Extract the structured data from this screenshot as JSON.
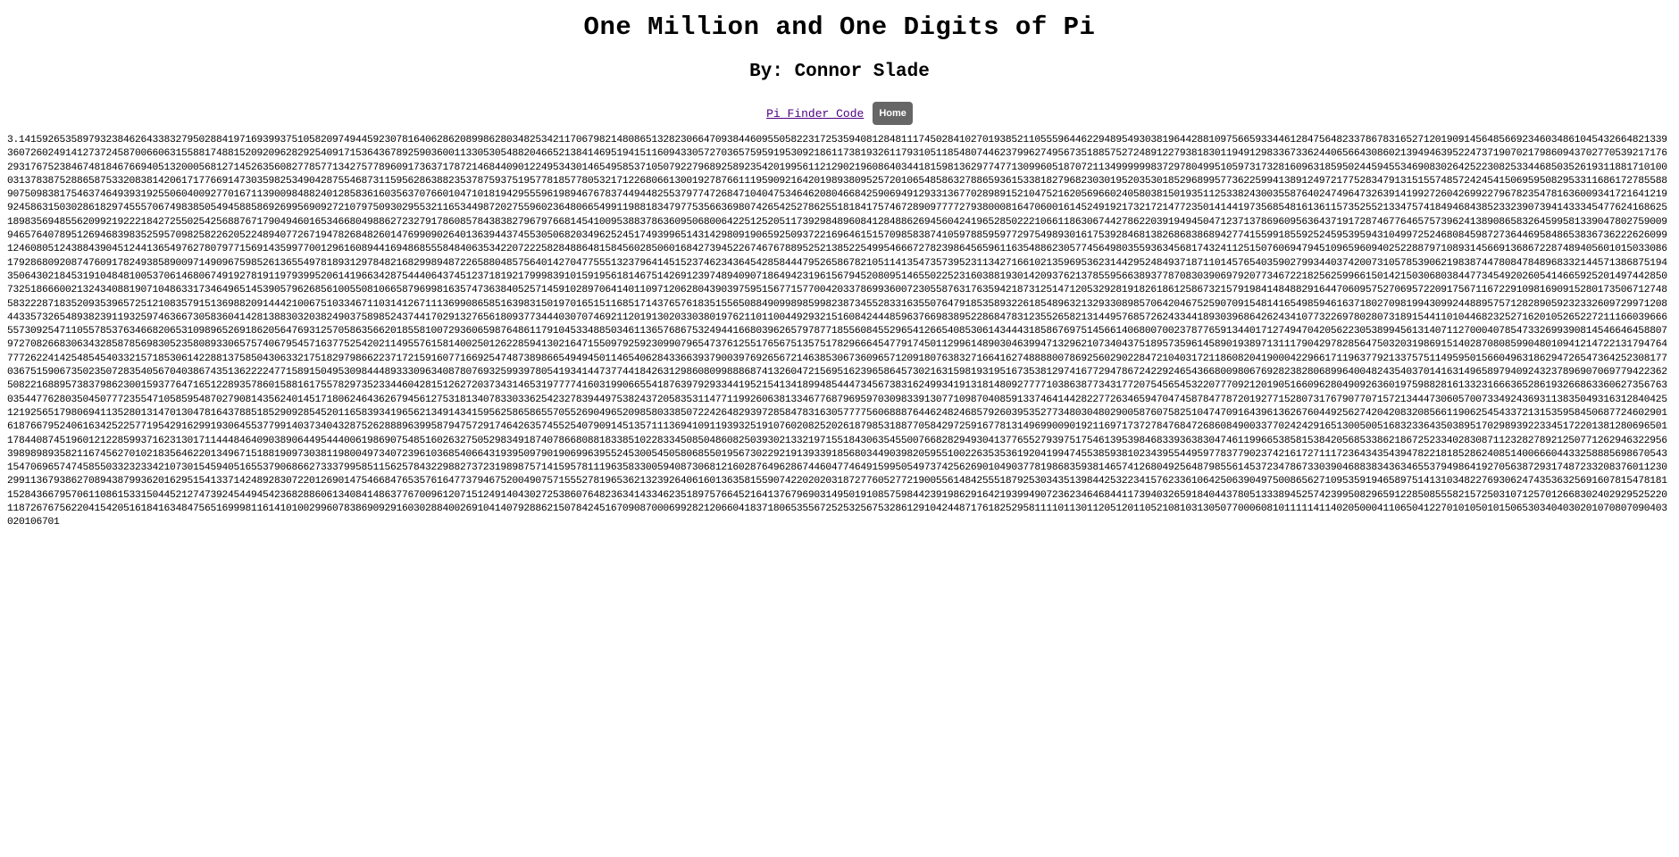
{
  "page": {
    "title": "One Million and One Digits of Pi",
    "subtitle": "By: Connor Slade"
  },
  "nav": {
    "link_label": "Pi Finder Code",
    "home_label": "Home"
  },
  "pi_digits": "3.14159265358979323846264338327950288419716939937510582097494459230781640628620899862803482534211706798214808651328230664709384460955058223172535940812848111745028410270193852110555964462294895493038196442881097566593344612847564823378678316527120190914564856692346034861045432664821339360726024914127372458700660631558817488152092096282925409171536436789259036001133053054882046652138414695194151160943305727036575959195309218611738193261179310511854807446237996274956735188575272489122793818301194912983367336244065664308602139494639522473719070217986094370277053921717629317675238467481846766940513200056812714526356082778577134275778960917363717872146844090122495343014654958537105079227968925892354201995611212902196086403441815981362977477130996051870721134999999837297804995105973173281609631859502445945534690830264252230825334468503526193118817101000313783875288658753320838142061717766914730359825349042875546873115956286388235378759375195778185778053217122680661300192787661119590921642019893809525720106548586327886593615338182796823030195203530185296899577362259941389124972177528347913151557485724245415069595082953311686172785588907509838175463746493931925506040092770167113900984882401285836160356370766010471018194295559619894676783744944825537977472684710404753464620804668425906949129331367702898915210475216205696602405803815019351125338243003558764024749647326391419927260426992279678235478163600934172164121992458631503028618297455570674983850549458858692699569092721079750930295532116534498720275596023648066549911988183479775356636980742654252786255181841757467289097777279380008164706001614524919217321721477235014144197356854816136115735255213347574184946843852332390739414333454776241686251898356948556209921922218427255025425688767179049460165346680498862723279178608578438382796797668145410095388378636095068006422512520511739298489608412848862694560424196528502221066118630674427862203919494504712371378696095636437191728746776465757396241389086583264599581339047802759009946576407895126946839835259570982582262052248940772671947826848260147699090264013639443745530506820349625245174939965143142980919065925093722169646151570985838741059788595977297549893016175392846813826868386894277415599185592524595395943104997252468084598727364469584865383673622262609912460805124388439045124413654976278079771569143599770012961608944169486855584840635342207222582848864815845602850601684273945226746767889525213852254995466672782398645659611635488623057745649803559363456817432411251507606947945109659609402522887971089314566913686722874894056010150330861792868092087476091782493858900971490967598526136554978189312978482168299894872265880485756401427047755513237964145152374623436454285844479526586782105114135473573952311342716610213596953623144295248493718711014576540359027993440374200731057853906219838744780847848968332144571386875194350643021845319104848100537061468067491927819119793995206141966342875444064374512371819217999839101591956181467514269123974894090718649423196156794520809514655022523160388193014209376213785595663893778708303906979207734672218256259966150142150306803844773454920260541466592520149744285073251866600213243408819071048633173464965145390579626856100550810665879699816357473638405257145910289706414011097120628043903975951567715770042033786993600723055876317635942187312514712053292819182618612586732157919841484882916447060957527069572209175671167229109816909152801735067127485832228718352093539657251210835791513698820914442100675103346711031412671113699086585163983150197016515116851714376576183515565088490998985998238734552833163550764791853589322618548963213293308985706420467525907091548141654985946163718027098199430992448895757128289059232332609729971208443357326548938239119325974636673058360414281388303203824903758985243744170291327656180937734440307074692112019130203303801976211011004492932151608424448596376698389522868478312355265821314495768572624334418930396864262434107732269780280731891544110104468232527162010526522721116603966655730925471105578537634668206531098965269186205647693125705863566201855810072936065987648611791045334885034611365768675324944166803962657978771855608455296541266540853061434443185867697514566140680070023787765913440171274947042056223053899456131407112700040785473326993908145466464588079727082668306343285878569830523580893306575740679545716377525420211495576158140025012622859413021647155097925923099079654737612551765675135751782966645477917450112996148903046399471329621073404375189573596145890193897131117904297828564750320319869151402870808599048010941214722131794764777262241425485454033215718530614228813758504306332175182979866223717215916077166925474873898665494945011465406284336639379003976926567214638530673609657120918076383271664162748888007869256029022847210403172118608204190004229661711963779213375751149595015660496318629472654736425230817703675159067350235072835405670403867435136222247715891504953098444893330963408780769325993978054193414473774418426312986080998886874132604721569516239658645730216315981931951673538129741677294786724229246543668009806769282382806899640048243540370141631496589794092432378969070697794223625082216889573837986230015937764716512289357860158816175578297352334460428151262720373431465319777741603199066554187639792933441952154134189948544473456738316249934191318148092777710386387734317720754565453220777092120190516609628049092636019759882816133231666365286193266863360627356763035447762803504507772355471058595487027908143562401451718062464362679456127531813407833033625423278394497538243720583531147711992606381334677687969597030983391307710987040859133746414428227726346594704745878477872019277152807317679077071572134447306057007334924369311383504931631284042512192565179806941135280131470130478164378851852909285452011658393419656213491434159562586586557055269049652098580338507224264829397285847831630577775606888764462482468579260395352773480304802900587607582510474709164396136267604492562742042083208566119062545433721315359584506877246029016187667952406163425225771954291629919306455377991403734043287526288896399587947572917464263574552540790914513571113694109119393251910760208252026187985318877058429725916778131496990090192116971737278476847268608490033770242429165130050051683233643503895170298939223345172201381280696501178440874519601212285993716231301711444846409038906449544400619869075485160263275052983491874078668088183385102283345085048608250393021332197155184306354550076682829493041377655279397517546139539846833936383047461199665385815384205685338621867252334028308711232827892125077126294632295639898989358211674562701021835646220134967151881909730381198004973407239610368540664319395097901906996395524530054505806855019567302292191393391856803449039820595510022635353619204199474553859381023439554495977837790237421617271117236434354394782218185286240851400666044332588856986705431547069657474585503323233421073015459405165537906866273337995851156257843229882737231989875714159578111963583300594087306812160287649628674460477464915995054973742562690104903778198683593814657412680492564879855614537234786733039046883834363465537949864192705638729317487233208376011230299113679386270894387993620162951541337142489283072201269014754668476535761647737946752004907571555278196536213239264061601363581559074220202031872776052772190055614842555187925303435139844253223415762336106425063904975008656271095359194658975141310348227693062474353632569160781547818115284366795706110861533150445212747392454494542368288606134084148637767009612071512491404302725386076482363414334623518975766452164137679690314950191085759844239198629164219399490723623464684411739403265918404437805133389452574239950829659122850855582157250310712570126683024029295252201187267675622041542051618416348475651699981161410100299607838690929160302884002691041407928862150784245167090870006992821206604183718065355672525325675328612910424487176182529581111011301120512011052108103130507700060810111114114020500041106504122701010501015065303404030201070807090403020106701",
  "colors": {
    "link": "#4b0082",
    "home_button_bg": "#666666",
    "home_button_text": "#ffffff"
  }
}
